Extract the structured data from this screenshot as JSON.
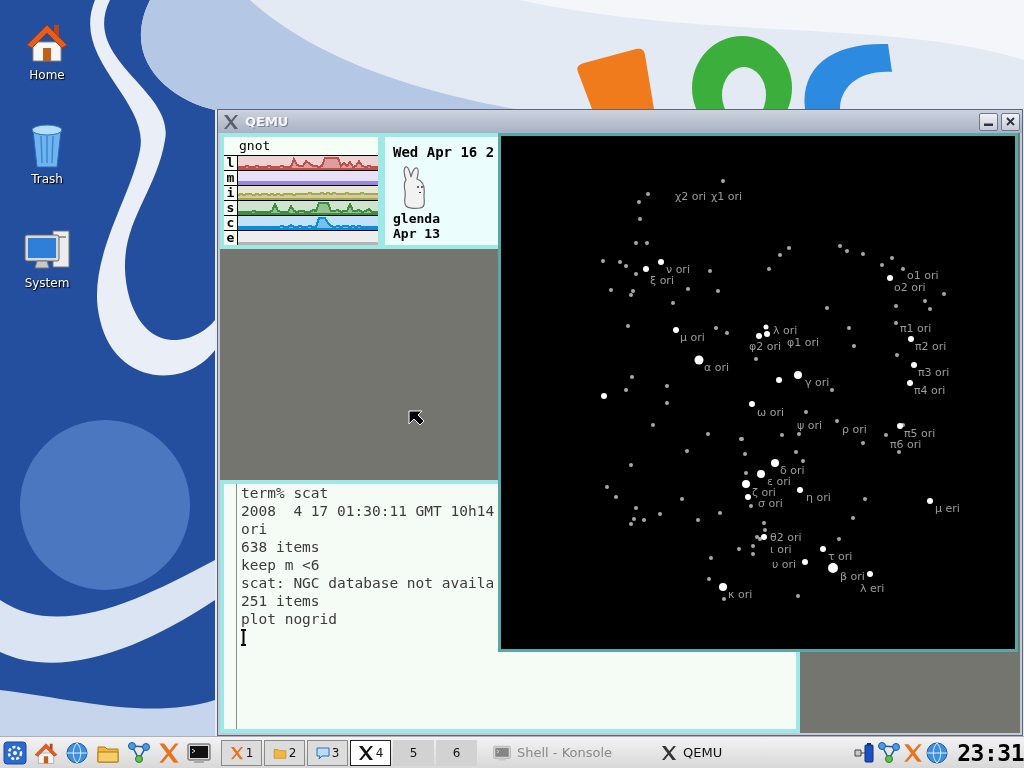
{
  "desktop_icons": [
    {
      "label": "Home"
    },
    {
      "label": "Trash"
    },
    {
      "label": "System"
    }
  ],
  "window": {
    "title": "QEMU"
  },
  "stats": {
    "title": "gnot",
    "rows": [
      {
        "label": "l",
        "color": "#c0504d"
      },
      {
        "label": "m",
        "color": "#9a88e0"
      },
      {
        "label": "i",
        "color": "#a8a650"
      },
      {
        "label": "s",
        "color": "#3d8f3d"
      },
      {
        "label": "c",
        "color": "#0a8de0"
      },
      {
        "label": "e",
        "color": "#b4b8b4"
      }
    ]
  },
  "faces": {
    "date": "Wed Apr 16 2",
    "user": "glenda",
    "user_date": "Apr 13"
  },
  "star_chart": {
    "labels": [
      "χ2 ori",
      "χ1 ori",
      "ν ori",
      "ξ ori",
      "ο1 ori",
      "ο2 ori",
      "μ ori",
      "λ ori",
      "φ1 ori",
      "φ2 ori",
      "π1 ori",
      "π2 ori",
      "π3 ori",
      "π4 ori",
      "α ori",
      "γ ori",
      "ω ori",
      "ψ ori",
      "ρ ori",
      "π5 ori",
      "π6 ori",
      "δ ori",
      "ε ori",
      "ζ ori",
      "σ ori",
      "η ori",
      "μ eri",
      "θ2 ori",
      "ι ori",
      "τ ori",
      "υ ori",
      "β ori",
      "λ eri",
      "κ ori"
    ]
  },
  "terminal": {
    "lines": [
      "term% scat",
      "2008  4 17 01:30:11 GMT 10h14",
      "ori",
      "638 items",
      "keep m <6",
      "scat: NGC database not availa",
      "251 items",
      "plot nogrid"
    ]
  },
  "taskbar": {
    "desktops": [
      {
        "label": "1",
        "selected": false
      },
      {
        "label": "2",
        "selected": false
      },
      {
        "label": "3",
        "selected": false
      },
      {
        "label": "4",
        "selected": true
      },
      {
        "label": "5",
        "selected": false
      },
      {
        "label": "6",
        "selected": false
      }
    ],
    "tasks": [
      {
        "label": "Shell - Konsole",
        "dimmed": true
      },
      {
        "label": "QEMU",
        "dimmed": false
      }
    ],
    "clock": "23:31"
  }
}
